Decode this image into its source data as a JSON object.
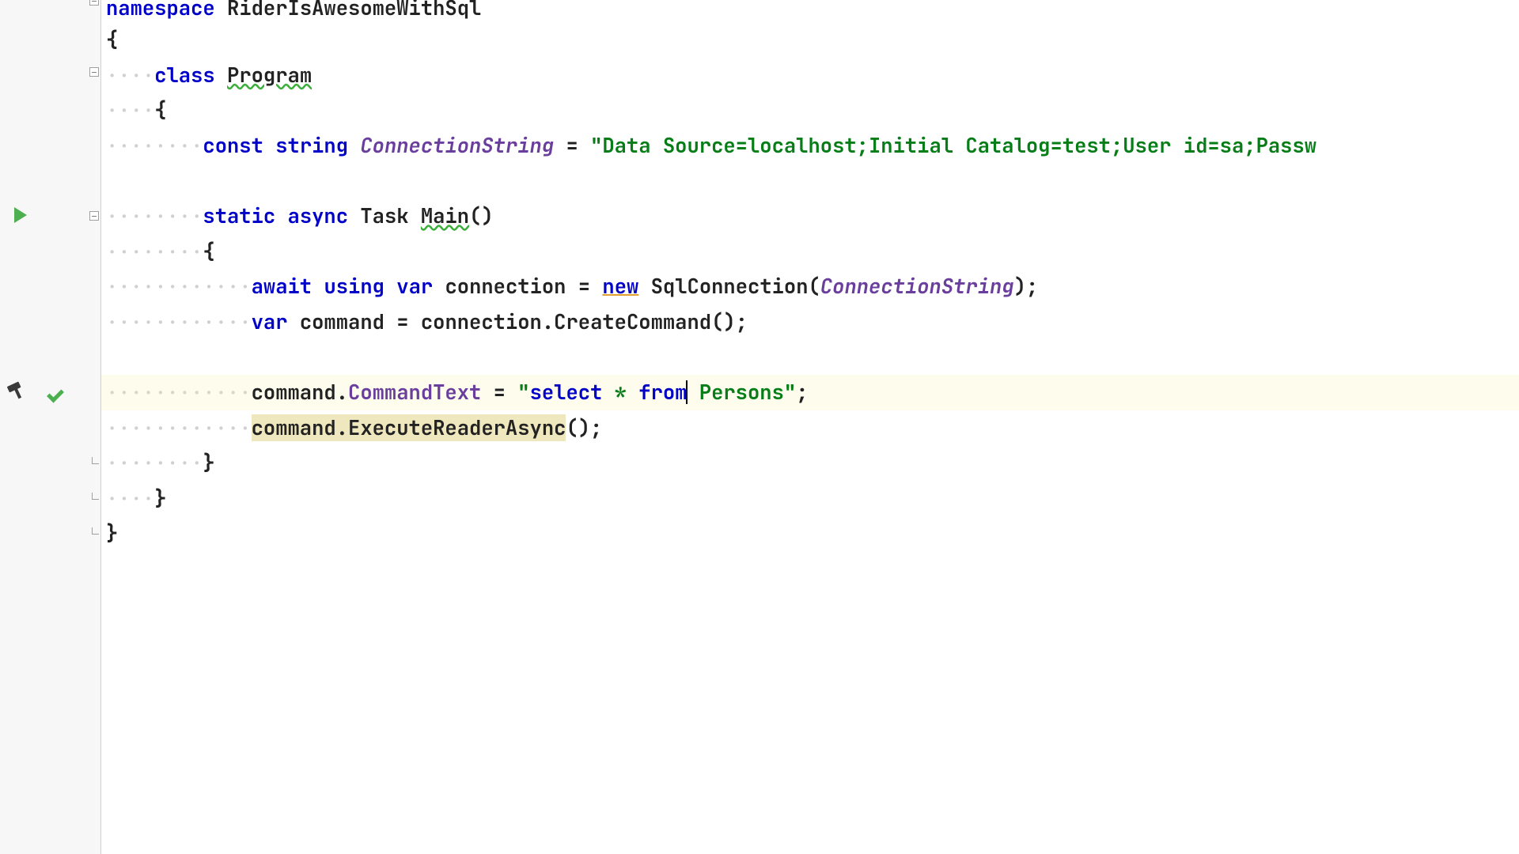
{
  "code": {
    "kw_namespace": "namespace",
    "ns_name": "RiderIsAwesomeWithSql",
    "brace_open": "{",
    "brace_close": "}",
    "kw_class": "class",
    "class_name": "Program",
    "kw_const": "const",
    "kw_string": "string",
    "const_name": "ConnectionString",
    "eq": " = ",
    "conn_str": "\"Data Source=localhost;Initial Catalog=test;User id=sa;Passw",
    "kw_static": "static",
    "kw_async": "async",
    "type_task": "Task",
    "method_main": "Main",
    "parens": "()",
    "kw_await": "await",
    "kw_using": "using",
    "kw_var": "var",
    "var_connection": "connection",
    "kw_new": "new",
    "type_sqlconn": "SqlConnection",
    "semi": ";",
    "var_command": "command",
    "call_createcmd": "CreateCommand",
    "dot": ".",
    "prop_cmdtext": "CommandText",
    "sql_open": "\"",
    "sql_select": "select",
    "sql_star": " * ",
    "sql_from": "from",
    "sql_persons": " Persons",
    "sql_close": "\"",
    "call_execreader": "ExecuteReaderAsync"
  },
  "indent": {
    "d1": "····",
    "d2": "········",
    "d3": "············"
  }
}
